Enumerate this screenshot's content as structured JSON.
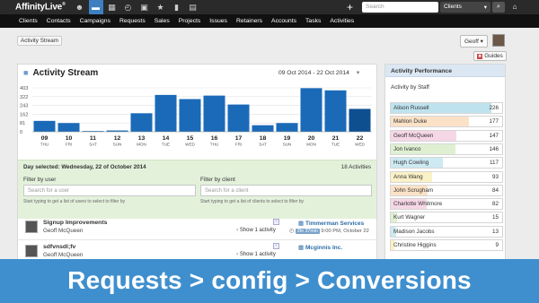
{
  "app": {
    "logo": "AffinityLive",
    "logo_mark": "®"
  },
  "topbar": {
    "icons": [
      {
        "name": "people-icon",
        "glyph": "☻"
      },
      {
        "name": "chat-icon",
        "glyph": "▬"
      },
      {
        "name": "grid-icon",
        "glyph": "▦"
      },
      {
        "name": "clock-icon",
        "glyph": "◴"
      },
      {
        "name": "calendar-icon",
        "glyph": "▣"
      },
      {
        "name": "star-icon",
        "glyph": "★"
      },
      {
        "name": "folder-icon",
        "glyph": "▮"
      },
      {
        "name": "inbox-icon",
        "glyph": "▤"
      }
    ],
    "plus_glyph": "+",
    "search_placeholder": "Search",
    "scope_value": "Clients",
    "scope_chevron": "▾",
    "search_glyph": "⌕",
    "home_glyph": "⌂"
  },
  "nav": {
    "items": [
      "Clients",
      "Contacts",
      "Campaigns",
      "Requests",
      "Sales",
      "Projects",
      "Issues",
      "Retainers",
      "Accounts",
      "Tasks",
      "Activities"
    ]
  },
  "breadcrumb": "Activity Stream",
  "user_menu": {
    "label": "Geoff",
    "chevron": "▾"
  },
  "guides": {
    "icon": "✖",
    "label": "Guides"
  },
  "stream": {
    "icon": "■",
    "title": "Activity Stream",
    "date_range": "09 Oct 2014 - 22 Oct 2014",
    "range_chevron": "▾"
  },
  "chart_data": {
    "type": "bar",
    "categories": [
      "09",
      "10",
      "11",
      "12",
      "13",
      "14",
      "15",
      "16",
      "17",
      "18",
      "19",
      "20",
      "21",
      "22"
    ],
    "weekdays": [
      "THU",
      "FRI",
      "SAT",
      "SUN",
      "MON",
      "TUE",
      "WED",
      "THU",
      "FRI",
      "SAT",
      "SUN",
      "MON",
      "TUE",
      "WED"
    ],
    "values": [
      100,
      80,
      7,
      12,
      170,
      338,
      300,
      332,
      250,
      60,
      80,
      400,
      380,
      210
    ],
    "yticks": [
      0,
      81,
      162,
      243,
      322,
      403
    ],
    "ylim": [
      0,
      403
    ],
    "grid": true,
    "color": "#1a6ab8",
    "highlight": "#0e4f90"
  },
  "day_selected": {
    "label": "Day selected: Wednesday, 22 of October 2014",
    "count": "18 Activities",
    "filter_user_label": "Filter by user",
    "filter_user_placeholder": "Search for a user",
    "filter_user_hint": "Start typing to get a list of users to select to filter by",
    "filter_client_label": "Filter by client",
    "filter_client_placeholder": "Search for a client",
    "filter_client_hint": "Start typing to get a list of clients to select to filter by"
  },
  "activities": [
    {
      "title": "Signup Improvements",
      "user": "Geoff McQueen",
      "show_label": "Show 1 activity",
      "client": "Timmerman Services",
      "duration": "3hr 37min",
      "time": "9:00 PM, October 22"
    },
    {
      "title": "sdfvnsdl;fv",
      "user": "Geoff McQueen",
      "show_label": "Show 1 activity",
      "client": "Mcginnis Inc.",
      "duration": "",
      "time": ""
    }
  ],
  "performance": {
    "title": "Activity Performance",
    "subtitle": "Activity by Staff",
    "max": 226,
    "staff": [
      {
        "name": "Alison Russell",
        "count": "226",
        "value": 226,
        "color": "#bfe3ee"
      },
      {
        "name": "Mahlon Duke",
        "count": "177",
        "value": 177,
        "color": "#fbe2c7"
      },
      {
        "name": "Geoff McQueen",
        "count": "147",
        "value": 147,
        "color": "#f6d7e6"
      },
      {
        "name": "Jon Ivanco",
        "count": "146",
        "value": 146,
        "color": "#dff0d2"
      },
      {
        "name": "Hugh Cowling",
        "count": "117",
        "value": 117,
        "color": "#cdeaf3"
      },
      {
        "name": "Anna Wang",
        "count": "93",
        "value": 93,
        "color": "#fbf1c7"
      },
      {
        "name": "John Scrugham",
        "count": "84",
        "value": 84,
        "color": "#fbe2c7"
      },
      {
        "name": "Charlotte Whitmore",
        "count": "82",
        "value": 82,
        "color": "#f6d7e6"
      },
      {
        "name": "Kurt Wagner",
        "count": "15",
        "value": 15,
        "color": "#dff0d2"
      },
      {
        "name": "Madison Jacobs",
        "count": "13",
        "value": 13,
        "color": "#cdeaf3"
      },
      {
        "name": "Christine Higgins",
        "count": "9",
        "value": 9,
        "color": "#fbf1c7"
      }
    ]
  },
  "banner": "Requests > config > Conversions"
}
